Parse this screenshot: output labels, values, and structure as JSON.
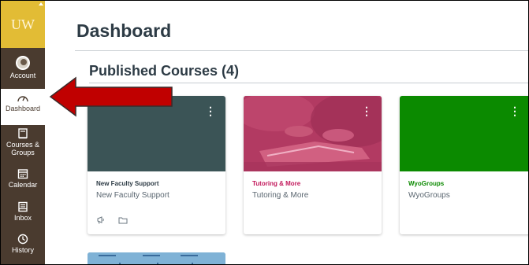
{
  "nav": {
    "logo_text": "UW",
    "items": [
      {
        "label": "Account",
        "icon": "avatar-icon"
      },
      {
        "label": "Dashboard",
        "icon": "dashboard-icon",
        "active": true
      },
      {
        "label": "Courses & Groups",
        "icon": "courses-icon"
      },
      {
        "label": "Calendar",
        "icon": "calendar-icon"
      },
      {
        "label": "Inbox",
        "icon": "inbox-icon"
      },
      {
        "label": "History",
        "icon": "history-icon"
      }
    ]
  },
  "main": {
    "title": "Dashboard",
    "section_title": "Published Courses (4)",
    "cards": [
      {
        "name": "New Faculty Support",
        "code": "New Faculty Support",
        "color": "#3b5456",
        "name_color": "#2d3b45"
      },
      {
        "name": "Tutoring & More",
        "code": "Tutoring & More",
        "color": "#b23a62",
        "name_color": "#c2185b"
      },
      {
        "name": "WyoGroups",
        "code": "WyoGroups",
        "color": "#0b8a00",
        "name_color": "#0b8a00"
      }
    ],
    "kebab": "⋮"
  },
  "colors": {
    "nav_bg": "#4a3b2f",
    "logo_bg": "#e2bc35",
    "arrow": "#c00000"
  }
}
